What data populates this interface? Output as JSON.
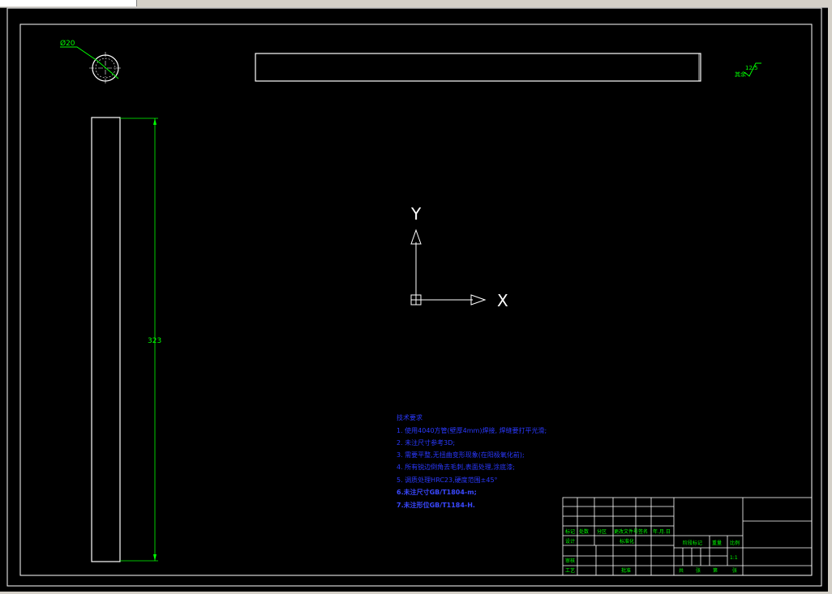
{
  "window": {
    "background_color": "#000000",
    "line_color": "#ffffff",
    "dimension_color": "#00ff00",
    "notes_color": "#2a39ff"
  },
  "drawing": {
    "diameter_label": "Ø20",
    "length_label": "323",
    "roughness_label": "其余",
    "roughness_value": "12.5"
  },
  "ucs": {
    "x_label": "X",
    "y_label": "Y"
  },
  "notes": {
    "title": "技术要求",
    "lines": [
      "1. 使用4040方管(壁厚4mm)焊接, 焊缝要打平光滑;",
      "2. 未注尺寸参考3D;",
      "3. 需要平整,无扭曲变形现象(在阳极氧化前);",
      "4. 所有锐边倒角去毛刺,表面处理,涂底漆;",
      "5. 调质处理HRC23,硬度范围±45°"
    ],
    "bold_lines": [
      "6.未注尺寸GB/T1804-m;",
      "7.未注形位GB/T1184-H."
    ]
  },
  "title_block": {
    "labels": {
      "mark": "标记",
      "count": "处数",
      "zone": "分区",
      "change_doc": "更改文件号",
      "sign": "签名",
      "date": "年.月.日",
      "design": "设计",
      "standard": "标准化",
      "stage_mark": "阶段标记",
      "weight": "重量",
      "scale": "比例",
      "scale_value": "1:1",
      "review": "审核",
      "process": "工艺",
      "approve": "批准",
      "total": "共",
      "sheets": "张",
      "page": "第",
      "sheet2": "张"
    }
  }
}
